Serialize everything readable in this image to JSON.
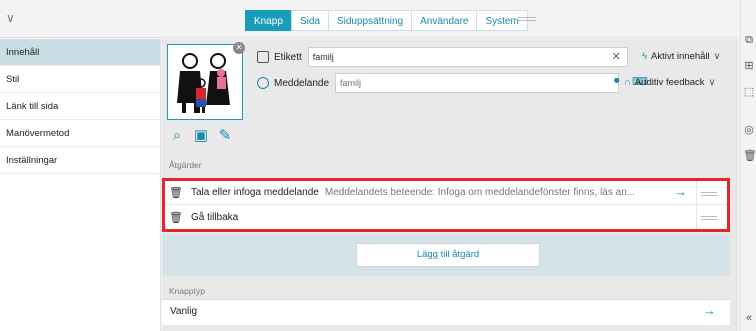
{
  "tabs": [
    "Knapp",
    "Sida",
    "Siduppsättning",
    "Användare",
    "System"
  ],
  "active_tab": "Knapp",
  "sidebar": {
    "items": [
      {
        "label": "Innehåll",
        "active": true
      },
      {
        "label": "Stil",
        "active": false
      },
      {
        "label": "Länk till sida",
        "active": false
      },
      {
        "label": "Manövermetod",
        "active": false
      },
      {
        "label": "Inställningar",
        "active": false
      }
    ]
  },
  "fields": {
    "label": {
      "name": "Etikett",
      "value": "familj",
      "dropdown": "Aktivt innehåll"
    },
    "message": {
      "name": "Meddelande",
      "placeholder": "familj",
      "dropdown": "Auditiv feedback"
    }
  },
  "actions": {
    "section_label": "Åtgärder",
    "items": [
      {
        "title": "Tala eller infoga meddelande",
        "description": "Meddelandets beteende: Infoga om meddelandefönster finns, läs an..."
      },
      {
        "title": "Gå tillbaka",
        "description": ""
      }
    ],
    "add_label": "Lägg till åtgärd"
  },
  "button_type": {
    "section_label": "Knapptyp",
    "value": "Vanlig"
  },
  "icons": {
    "top_collapse": "chevron-double-down-icon",
    "right_rail": [
      "copy-icon",
      "grid-icon",
      "select-icon",
      "hide-icon",
      "trash-icon",
      "collapse-left-icon"
    ],
    "image_tools": [
      "search-icon",
      "camera-icon",
      "edit-icon"
    ]
  },
  "colors": {
    "accent": "#1a9dbb",
    "highlight_border": "#e8232a",
    "sidebar_active": "#c9dde5"
  }
}
